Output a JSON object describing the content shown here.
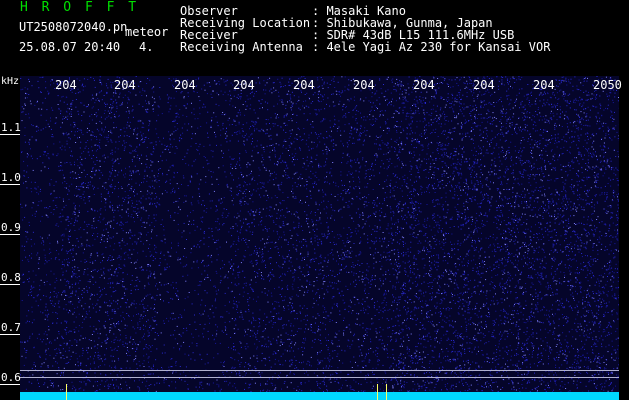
{
  "header": {
    "title": "H R O F F T",
    "filename": "UT2508072040.pn",
    "tag": "meteor",
    "datetime": "25.08.07 20:40",
    "sub": "4.",
    "info": [
      {
        "label": "Observer",
        "value": ": Masaki Kano"
      },
      {
        "label": "Receiving Location",
        "value": ": Shibukawa, Gunma, Japan"
      },
      {
        "label": "Receiver",
        "value": ": SDR# 43dB L15 111.6MHz USB"
      },
      {
        "label": "Receiving Antenna",
        "value": ": 4ele Yagi Az 230 for Kansai VOR"
      }
    ]
  },
  "spectrogram": {
    "y_unit": "kHz",
    "y_ticks": [
      "1.1",
      "1.0",
      "0.9",
      "0.8",
      "0.7",
      "0.6"
    ],
    "x_ticks": [
      "204",
      "204",
      "204",
      "204",
      "204",
      "204",
      "204",
      "204",
      "204",
      "2050"
    ],
    "colors": {
      "background": "#05052a",
      "noise": "#3a3aff",
      "trace": "#00d8ff",
      "marker": "#ffff60",
      "title": "#00e000"
    }
  }
}
